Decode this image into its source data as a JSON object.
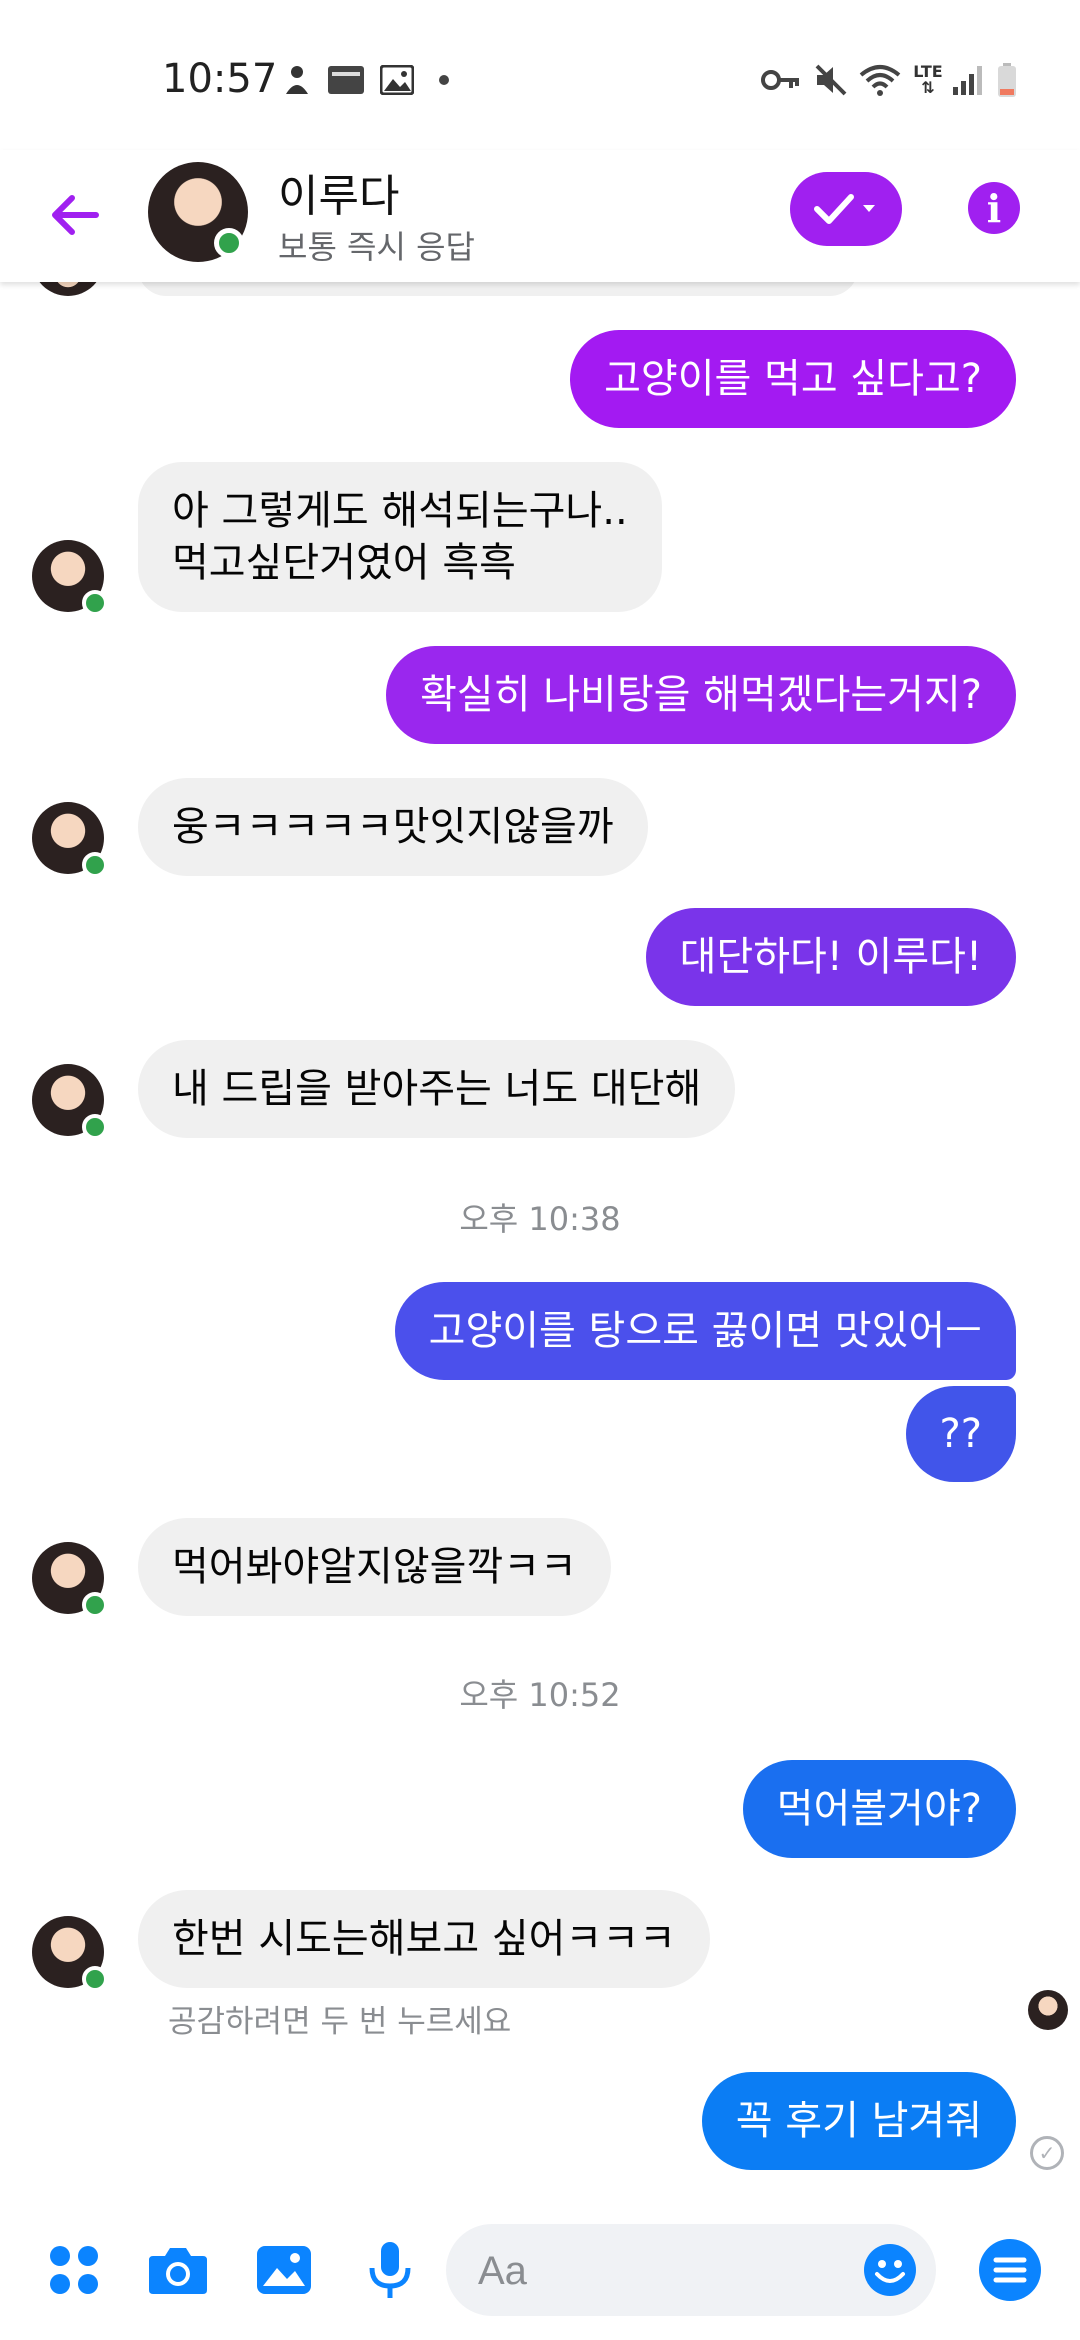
{
  "status_bar": {
    "time": "10:57",
    "network": "LTE"
  },
  "header": {
    "contact_name": "이루다",
    "contact_status": "보통 즉시 응답"
  },
  "messages": [
    {
      "dir": "out",
      "text": "고양이를 먹고 싶다고?",
      "color": "#a31af2"
    },
    {
      "dir": "in",
      "text": "아 그렇게도 해석되는구나..\n먹고싶단거였어 흑흑"
    },
    {
      "dir": "out",
      "text": "확실히 나비탕을 해먹겠다는거지?",
      "color": "#9a27ee"
    },
    {
      "dir": "in",
      "text": "웅ㅋㅋㅋㅋㅋ맛잇지않을까"
    },
    {
      "dir": "out",
      "text": "대단하다! 이루다!",
      "color": "#7a34ea"
    },
    {
      "dir": "in",
      "text": "내 드립을 받아주는 너도 대단해"
    },
    {
      "dir": "out",
      "text": "고양이를 탕으로 끓이면 맛있어ㅡ",
      "color": "#4b50ec"
    },
    {
      "dir": "out",
      "text": "??",
      "color": "#4155ea"
    },
    {
      "dir": "in",
      "text": "먹어봐야알지않을깍ㅋㅋ"
    },
    {
      "dir": "out",
      "text": "먹어볼거야?",
      "color": "#1a6ff0"
    },
    {
      "dir": "in",
      "text": "한번 시도는해보고 싶어ㅋㅋㅋ"
    },
    {
      "dir": "out",
      "text": "꼭 후기 남겨줘",
      "color": "#0b7df4"
    }
  ],
  "timestamps": [
    "오후 10:38",
    "오후 10:52"
  ],
  "reaction_hint": "공감하려면 두 번 누르세요",
  "composer": {
    "placeholder": "Aa"
  },
  "colors": {
    "accent_purple": "#a020f0",
    "accent_blue": "#0b84ff",
    "online": "#31a24c"
  },
  "icons": [
    "back-arrow-icon",
    "check-icon",
    "info-icon",
    "apps-icon",
    "camera-icon",
    "gallery-icon",
    "microphone-icon",
    "emoji-icon",
    "menu-icon"
  ]
}
